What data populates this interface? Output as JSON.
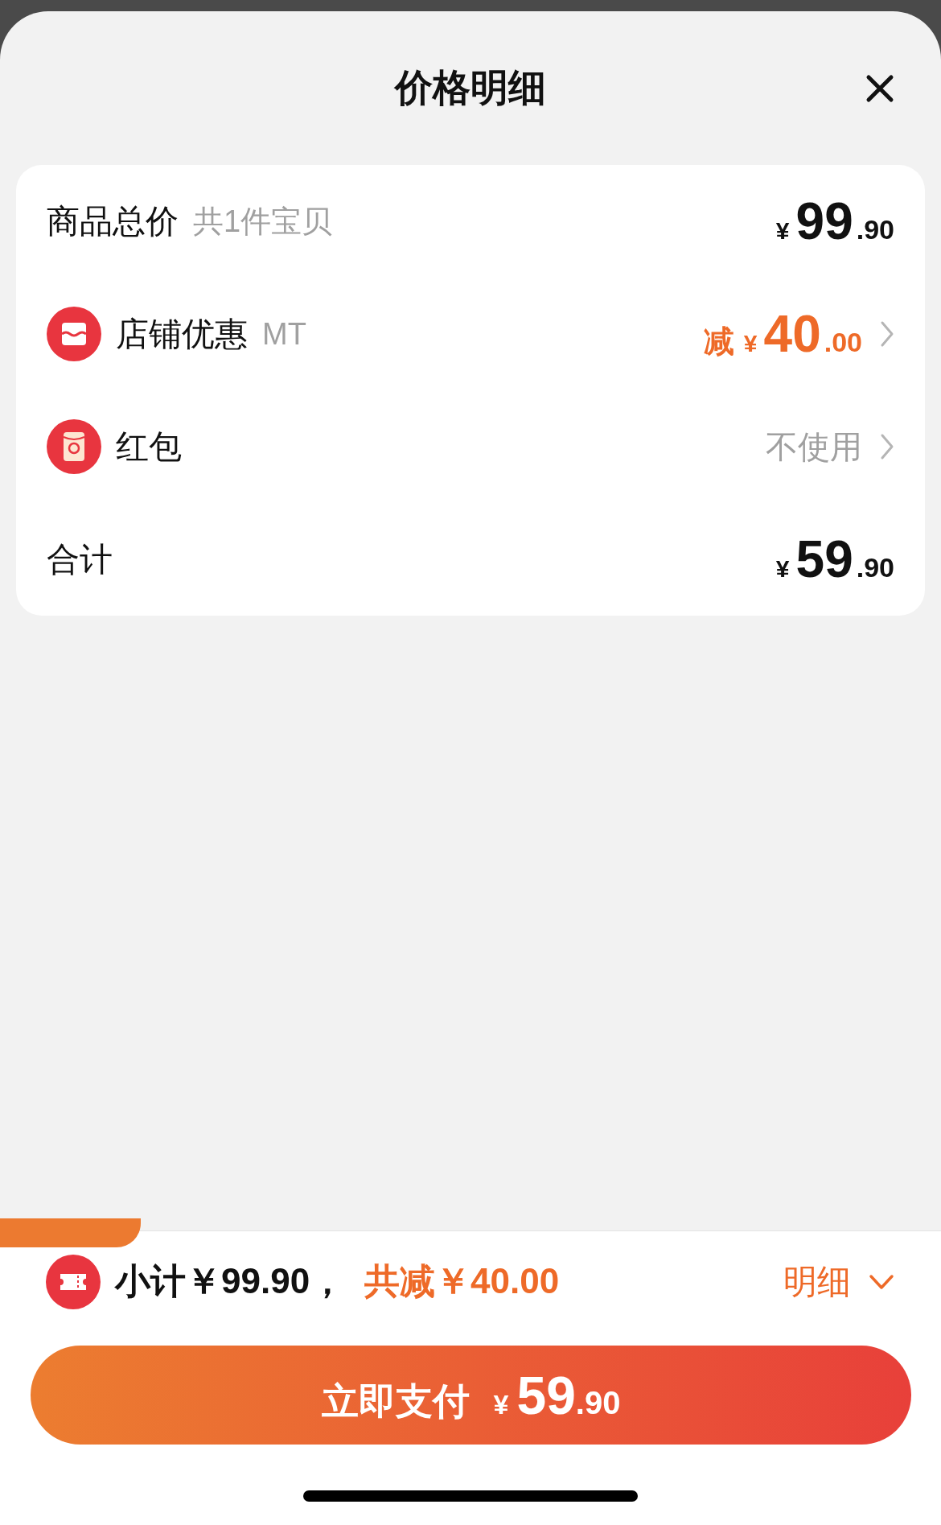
{
  "sheet": {
    "title": "价格明细"
  },
  "rows": [
    {
      "kind": "total",
      "label": "商品总价",
      "note": "共1件宝贝",
      "price": {
        "currency": "¥",
        "integer": "99",
        "decimal": ".90"
      }
    },
    {
      "kind": "discount",
      "label": "店铺优惠",
      "note": "MT",
      "prefix": "减",
      "price": {
        "currency": "¥",
        "integer": "40",
        "decimal": ".00"
      }
    },
    {
      "kind": "option",
      "label": "红包",
      "value": "不使用"
    },
    {
      "kind": "total",
      "label": "合计",
      "price": {
        "currency": "¥",
        "integer": "59",
        "decimal": ".90"
      }
    }
  ],
  "footer": {
    "subtotal": "小计￥99.90，",
    "discount": "共减￥40.00",
    "details": "明细"
  },
  "pay_button": {
    "label": "立即支付",
    "currency": "¥",
    "integer": "59",
    "decimal": ".90"
  }
}
